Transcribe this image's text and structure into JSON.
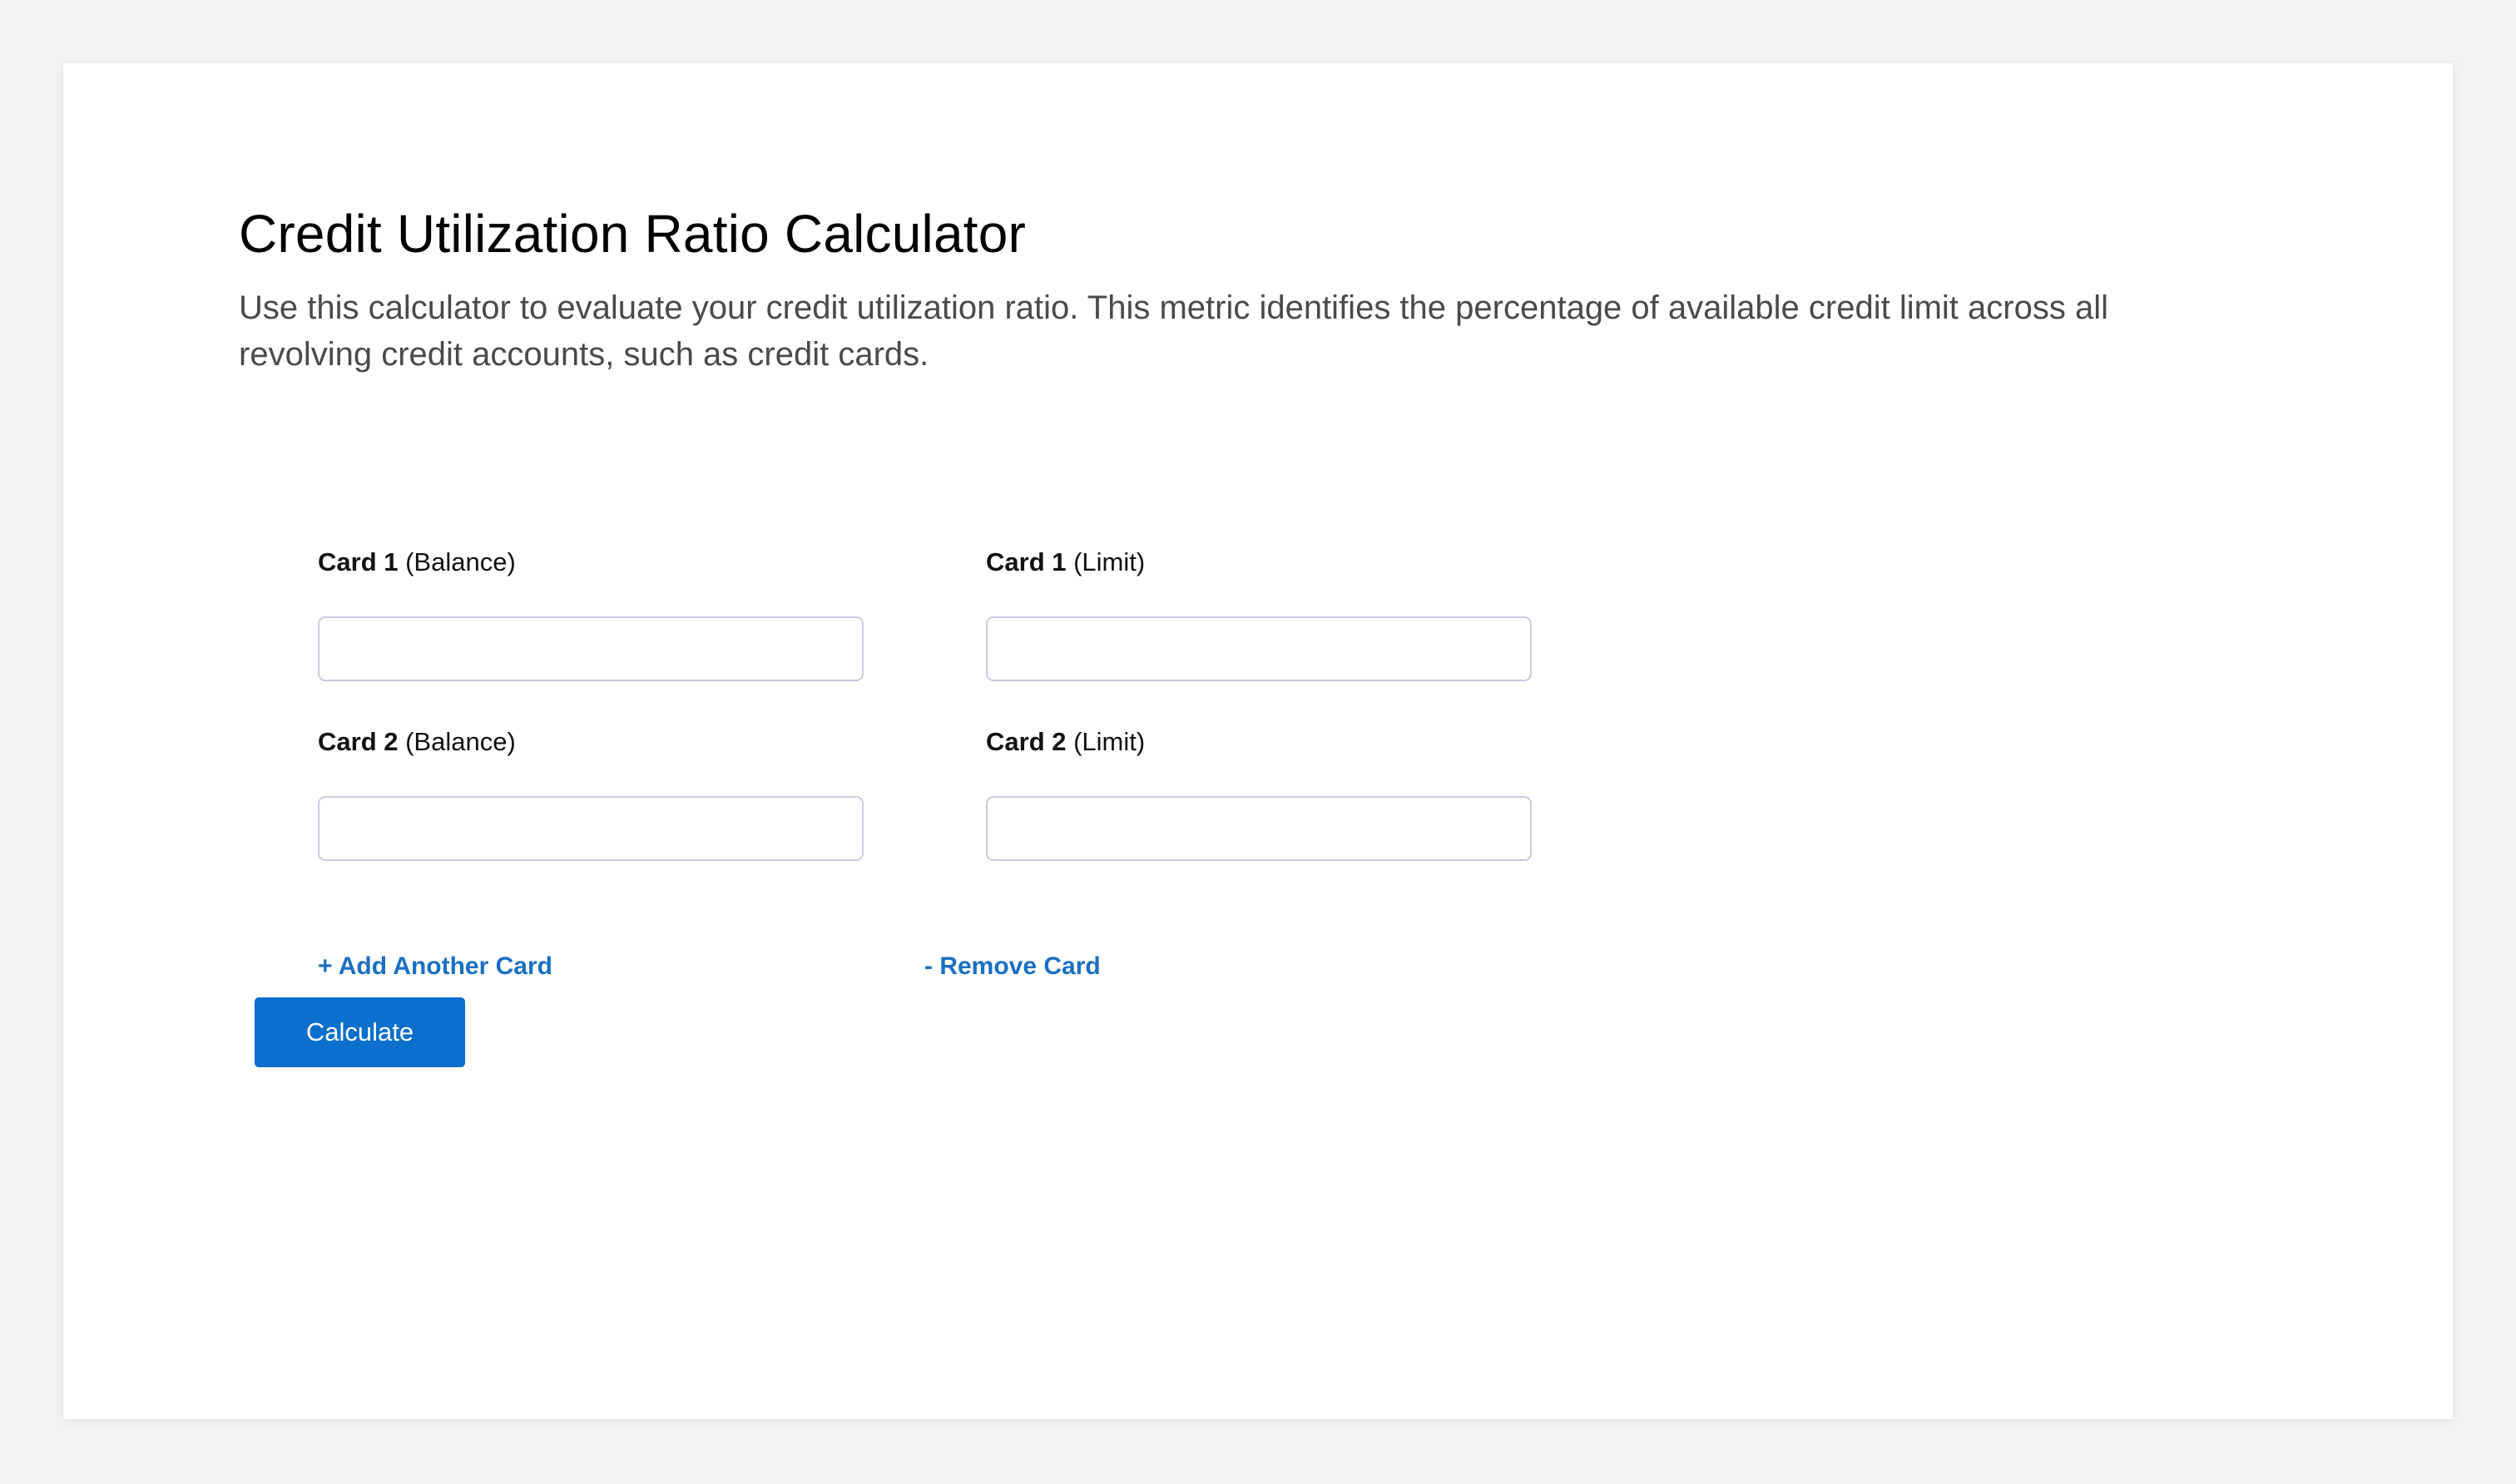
{
  "page": {
    "title": "Credit Utilization Ratio Calculator",
    "description": "Use this calculator to evaluate your credit utilization ratio. This metric identifies the percentage of available credit limit across all revolving credit accounts, such as credit cards."
  },
  "form": {
    "rows": [
      {
        "balance": {
          "label_bold": "Card 1",
          "label_rest": "(Balance)",
          "value": "",
          "placeholder": ""
        },
        "limit": {
          "label_bold": "Card 1",
          "label_rest": "(Limit)",
          "value": "",
          "placeholder": ""
        }
      },
      {
        "balance": {
          "label_bold": "Card 2",
          "label_rest": "(Balance)",
          "value": "",
          "placeholder": ""
        },
        "limit": {
          "label_bold": "Card 2",
          "label_rest": "(Limit)",
          "value": "",
          "placeholder": ""
        }
      }
    ],
    "add_card_label": "+ Add Another Card",
    "remove_card_label": "- Remove Card",
    "calculate_label": "Calculate"
  },
  "colors": {
    "page_background": "#f3f3f3",
    "panel_background": "#ffffff",
    "link": "#1a6fc2",
    "button": "#0a6fcd",
    "input_border": "#c9cbe0"
  }
}
